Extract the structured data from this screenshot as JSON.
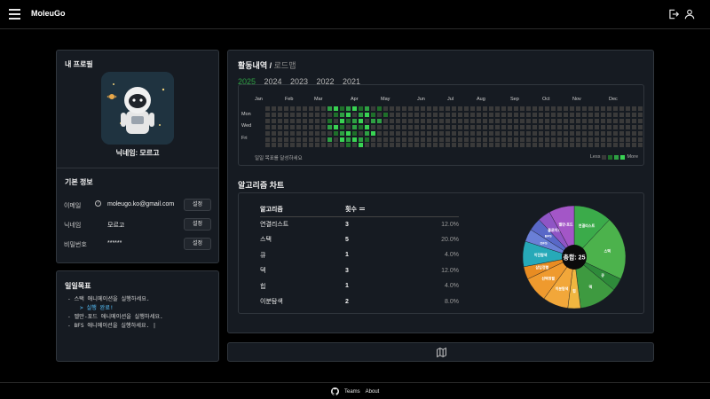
{
  "app": {
    "brand": "MoleuGo"
  },
  "profile": {
    "title": "내 프로필",
    "nickname_line": "닉네임: 모르고",
    "basic_info_title": "기본 정보",
    "rows": [
      {
        "label": "이메일",
        "value": "moleugo.ko@gmail.com",
        "button": "설정",
        "help": "?"
      },
      {
        "label": "닉네임",
        "value": "모르고",
        "button": "설정"
      },
      {
        "label": "비밀번호",
        "value": "******",
        "button": "설정"
      }
    ]
  },
  "daily_goal": {
    "title": "일일목표",
    "items": [
      "- 스택 애니메이션을 실행하세요.",
      "> 실행 완료!",
      "- 벨만-포드 애니메이션을 실행하세요.",
      "- BFS 애니메이션을 실행하세요. |"
    ]
  },
  "activity": {
    "title": "활동내역",
    "sep": " / ",
    "roadmap": "로드맵",
    "years": [
      "2025",
      "2024",
      "2023",
      "2022",
      "2021"
    ],
    "active_year": "2025",
    "months": [
      "Jan",
      "Feb",
      "Mar",
      "Apr",
      "May",
      "Jun",
      "Jul",
      "Aug",
      "Sep",
      "Oct",
      "Nov",
      "Dec"
    ],
    "day_labels": [
      "Mon",
      "Wed",
      "Fri"
    ],
    "note": "일일 목표를 달성하세요",
    "legend_less": "Less",
    "legend_more": "More",
    "colors": {
      "empty": "#3a3a3a",
      "l1": "#1f6f2a",
      "l2": "#2ea043",
      "l3": "#39d353"
    }
  },
  "algorithm": {
    "title": "알고리즘 차트",
    "headers": {
      "name": "알고리즘",
      "count": "횟수"
    },
    "rows": [
      {
        "name": "연결리스트",
        "count": "3",
        "pct": "12.0%"
      },
      {
        "name": "스택",
        "count": "5",
        "pct": "20.0%"
      },
      {
        "name": "큐",
        "count": "1",
        "pct": "4.0%"
      },
      {
        "name": "덱",
        "count": "3",
        "pct": "12.0%"
      },
      {
        "name": "힙",
        "count": "1",
        "pct": "4.0%"
      },
      {
        "name": "이분탐색",
        "count": "2",
        "pct": "8.0%"
      }
    ],
    "total_label": "총합: 25"
  },
  "chart_data": {
    "type": "pie",
    "title": "",
    "center_label": "총합: 25",
    "slices": [
      {
        "label": "연결리스트",
        "value": 3,
        "color": "#3bab4a"
      },
      {
        "label": "스택",
        "value": 5,
        "color": "#4cb24c"
      },
      {
        "label": "큐",
        "value": 1,
        "color": "#2e8b3a"
      },
      {
        "label": "덱",
        "value": 3,
        "color": "#3e9a40"
      },
      {
        "label": "힙",
        "value": 1,
        "color": "#f0b640"
      },
      {
        "label": "이분탐색",
        "value": 2,
        "color": "#f2a73a"
      },
      {
        "label": "선택정렬",
        "value": 2,
        "color": "#ef9a2e"
      },
      {
        "label": "삽입정렬",
        "value": 1,
        "color": "#e88c22"
      },
      {
        "label": "이진탐색",
        "value": 2,
        "color": "#27a9b8"
      },
      {
        "label": "DFS",
        "value": 1,
        "color": "#6a7fd6"
      },
      {
        "label": "BFS",
        "value": 1,
        "color": "#5968c8"
      },
      {
        "label": "플로이드",
        "value": 1,
        "color": "#8f55c5"
      },
      {
        "label": "벨만-포드",
        "value": 2,
        "color": "#a356c7"
      }
    ]
  },
  "footer": {
    "teams": "Teams",
    "about": "About"
  }
}
